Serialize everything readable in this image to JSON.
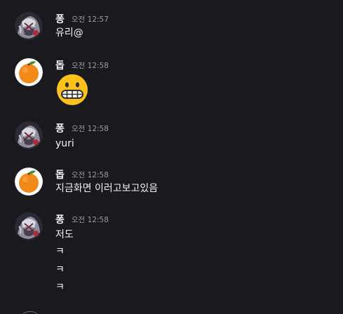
{
  "messages": [
    {
      "author": "퐁",
      "time": "오전 12:57",
      "avatar_icon": "anime-character-avatar-icon",
      "lines": [
        "유리@"
      ]
    },
    {
      "author": "돕",
      "time": "오전 12:58",
      "avatar_icon": "orange-fruit-avatar-icon",
      "emoji": "grimacing-face-emoji",
      "lines": []
    },
    {
      "author": "퐁",
      "time": "오전 12:58",
      "avatar_icon": "anime-character-avatar-icon",
      "lines": [
        "yuri"
      ]
    },
    {
      "author": "돕",
      "time": "오전 12:58",
      "avatar_icon": "orange-fruit-avatar-icon",
      "lines": [
        "지금화면 이러고보고있음"
      ]
    },
    {
      "author": "퐁",
      "time": "오전 12:58",
      "avatar_icon": "anime-character-avatar-icon",
      "lines": [
        "저도",
        "ㅋ",
        "ㅋ",
        "ㅋ"
      ]
    }
  ],
  "colors": {
    "background": "#1a1a1e",
    "username": "#f2f3f5",
    "timestamp": "#949ba4",
    "text": "#f2f3f5",
    "orange": "#f28a1a",
    "emoji_yellow": "#fcc21b"
  }
}
